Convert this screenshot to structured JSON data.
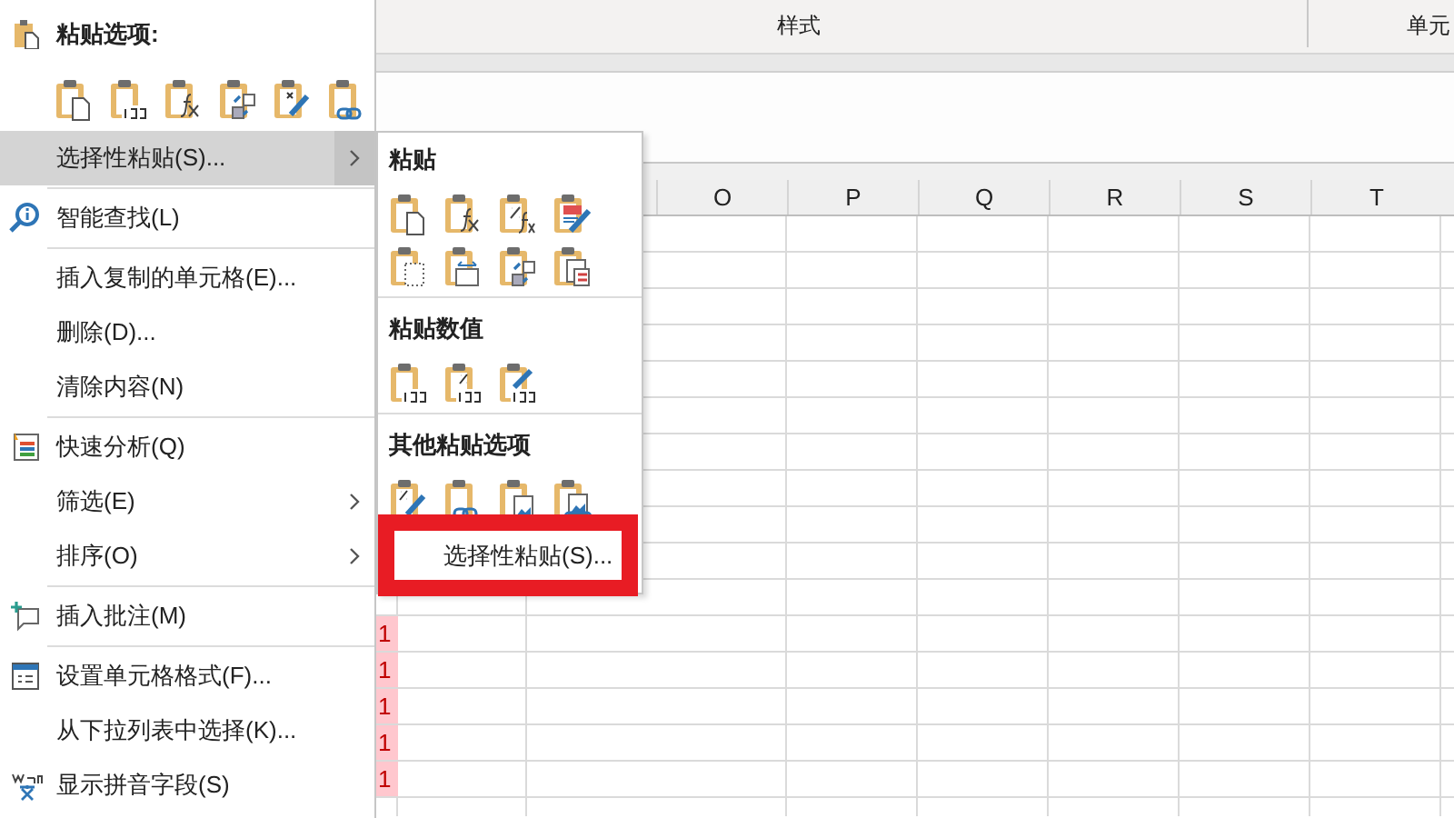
{
  "ribbon": {
    "groups": [
      {
        "label": "样式"
      },
      {
        "label": "单元"
      }
    ]
  },
  "sheet": {
    "columns": [
      "O",
      "P",
      "Q",
      "R",
      "S",
      "T"
    ],
    "values": [
      "1",
      "1",
      "1",
      "1",
      "1"
    ]
  },
  "context_menu": {
    "paste_options": {
      "label": "粘贴选项:"
    },
    "groups": [
      [
        {
          "label": "选择性粘贴(S)...",
          "kind": "plain",
          "selected": true,
          "submenu": true
        }
      ],
      [
        {
          "label": "智能查找(L)",
          "kind": "lookup",
          "selected": false,
          "submenu": false
        }
      ],
      [
        {
          "label": "插入复制的单元格(E)...",
          "kind": "plain",
          "selected": false,
          "submenu": false
        },
        {
          "label": "删除(D)...",
          "kind": "plain",
          "selected": false,
          "submenu": false
        },
        {
          "label": "清除内容(N)",
          "kind": "plain",
          "selected": false,
          "submenu": false
        }
      ],
      [
        {
          "label": "快速分析(Q)",
          "kind": "analysis",
          "selected": false,
          "submenu": false
        },
        {
          "label": "筛选(E)",
          "kind": "plain",
          "selected": false,
          "submenu": true
        },
        {
          "label": "排序(O)",
          "kind": "plain",
          "selected": false,
          "submenu": true
        }
      ],
      [
        {
          "label": "插入批注(M)",
          "kind": "comment",
          "selected": false,
          "submenu": false
        }
      ],
      [
        {
          "label": "设置单元格格式(F)...",
          "kind": "format",
          "selected": false,
          "submenu": false
        },
        {
          "label": "从下拉列表中选择(K)...",
          "kind": "plain",
          "selected": false,
          "submenu": false
        },
        {
          "label": "显示拼音字段(S)",
          "kind": "phonetic",
          "selected": false,
          "submenu": false
        }
      ]
    ]
  },
  "submenu": {
    "sections": [
      {
        "title": "粘贴"
      },
      {
        "title": "粘贴数值"
      },
      {
        "title": "其他粘贴选项"
      }
    ],
    "footer": {
      "label": "选择性粘贴(S)...",
      "highlighted": true
    }
  }
}
